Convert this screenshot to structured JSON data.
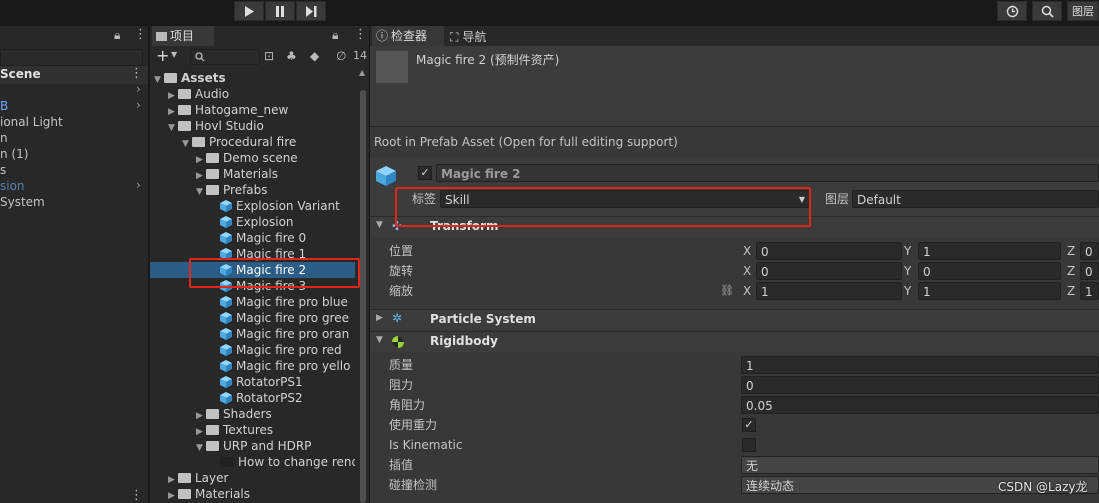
{
  "toolbar": {
    "play_icon": "play-icon",
    "pause_icon": "pause-icon",
    "step_icon": "step-icon",
    "layers_label": "图层"
  },
  "hierarchy": {
    "items": [
      {
        "label": "Scene"
      },
      {
        "label": "B"
      },
      {
        "label": "ional Light"
      },
      {
        "label": "n"
      },
      {
        "label": "n (1)"
      },
      {
        "label": "s"
      },
      {
        "label": "sion"
      },
      {
        "label": "System"
      }
    ]
  },
  "project": {
    "tab_label": "项目",
    "search_placeholder": "",
    "hidden_count": "14",
    "tree": [
      {
        "label": "Assets",
        "depth": 0,
        "kind": "folder",
        "expanded": true,
        "bold": true
      },
      {
        "label": "Audio",
        "depth": 1,
        "kind": "folder",
        "expanded": false
      },
      {
        "label": "Hatogame_new",
        "depth": 1,
        "kind": "folder",
        "expanded": false
      },
      {
        "label": "Hovl Studio",
        "depth": 1,
        "kind": "folder",
        "expanded": true
      },
      {
        "label": "Procedural fire",
        "depth": 2,
        "kind": "folder",
        "expanded": true
      },
      {
        "label": "Demo scene",
        "depth": 3,
        "kind": "folder",
        "expanded": false
      },
      {
        "label": "Materials",
        "depth": 3,
        "kind": "folder",
        "expanded": false
      },
      {
        "label": "Prefabs",
        "depth": 3,
        "kind": "folder",
        "expanded": true
      },
      {
        "label": "Explosion Variant",
        "depth": 4,
        "kind": "prefab"
      },
      {
        "label": "Explosion",
        "depth": 4,
        "kind": "prefab"
      },
      {
        "label": "Magic fire 0",
        "depth": 4,
        "kind": "prefab"
      },
      {
        "label": "Magic fire 1",
        "depth": 4,
        "kind": "prefab"
      },
      {
        "label": "Magic fire 2",
        "depth": 4,
        "kind": "prefab",
        "selected": true
      },
      {
        "label": "Magic fire 3",
        "depth": 4,
        "kind": "prefab"
      },
      {
        "label": "Magic fire pro blue",
        "depth": 4,
        "kind": "prefab"
      },
      {
        "label": "Magic fire pro gree",
        "depth": 4,
        "kind": "prefab"
      },
      {
        "label": "Magic fire pro oran",
        "depth": 4,
        "kind": "prefab"
      },
      {
        "label": "Magic fire pro red",
        "depth": 4,
        "kind": "prefab"
      },
      {
        "label": "Magic fire pro yello",
        "depth": 4,
        "kind": "prefab"
      },
      {
        "label": "RotatorPS1",
        "depth": 4,
        "kind": "prefab"
      },
      {
        "label": "RotatorPS2",
        "depth": 4,
        "kind": "prefab"
      },
      {
        "label": "Shaders",
        "depth": 3,
        "kind": "folder",
        "expanded": false
      },
      {
        "label": "Textures",
        "depth": 3,
        "kind": "folder",
        "expanded": false
      },
      {
        "label": "URP and HDRP",
        "depth": 3,
        "kind": "folder",
        "expanded": true
      },
      {
        "label": "How to change rend",
        "depth": 4,
        "kind": "file"
      },
      {
        "label": "Layer",
        "depth": 1,
        "kind": "folder",
        "expanded": false
      },
      {
        "label": "Materials",
        "depth": 1,
        "kind": "folder",
        "expanded": false
      }
    ]
  },
  "inspector": {
    "tab_inspector": "检查器",
    "tab_navigation": "导航",
    "asset_title": "Magic fire 2 (预制件资产)",
    "prefab_note": "Root in Prefab Asset (Open for full editing support)",
    "object_name": "Magic fire 2",
    "tag_label": "标签",
    "tag_value": "Skill",
    "layer_label": "图层",
    "layer_value": "Default",
    "transform": {
      "title": "Transform",
      "position_label": "位置",
      "rotation_label": "旋转",
      "scale_label": "缩放",
      "axis_x": "X",
      "axis_y": "Y",
      "axis_z": "Z",
      "position": {
        "x": "0",
        "y": "1",
        "z": "0"
      },
      "rotation": {
        "x": "0",
        "y": "0",
        "z": "0"
      },
      "scale": {
        "x": "1",
        "y": "1",
        "z": "1"
      }
    },
    "particle_system": {
      "title": "Particle System"
    },
    "rigidbody": {
      "title": "Rigidbody",
      "mass_label": "质量",
      "mass": "1",
      "drag_label": "阻力",
      "drag": "0",
      "angular_drag_label": "角阻力",
      "angular_drag": "0.05",
      "use_gravity_label": "使用重力",
      "use_gravity": true,
      "is_kinematic_label": "Is Kinematic",
      "is_kinematic": false,
      "interpolate_label": "插值",
      "interpolate": "无",
      "collision_label": "碰撞检测",
      "collision": "连续动态"
    }
  },
  "watermark": "CSDN @Lazy龙",
  "colors": {
    "highlight": "#e0251b",
    "selection": "#2c5d87",
    "prefab_blue": "#5db8f0"
  }
}
